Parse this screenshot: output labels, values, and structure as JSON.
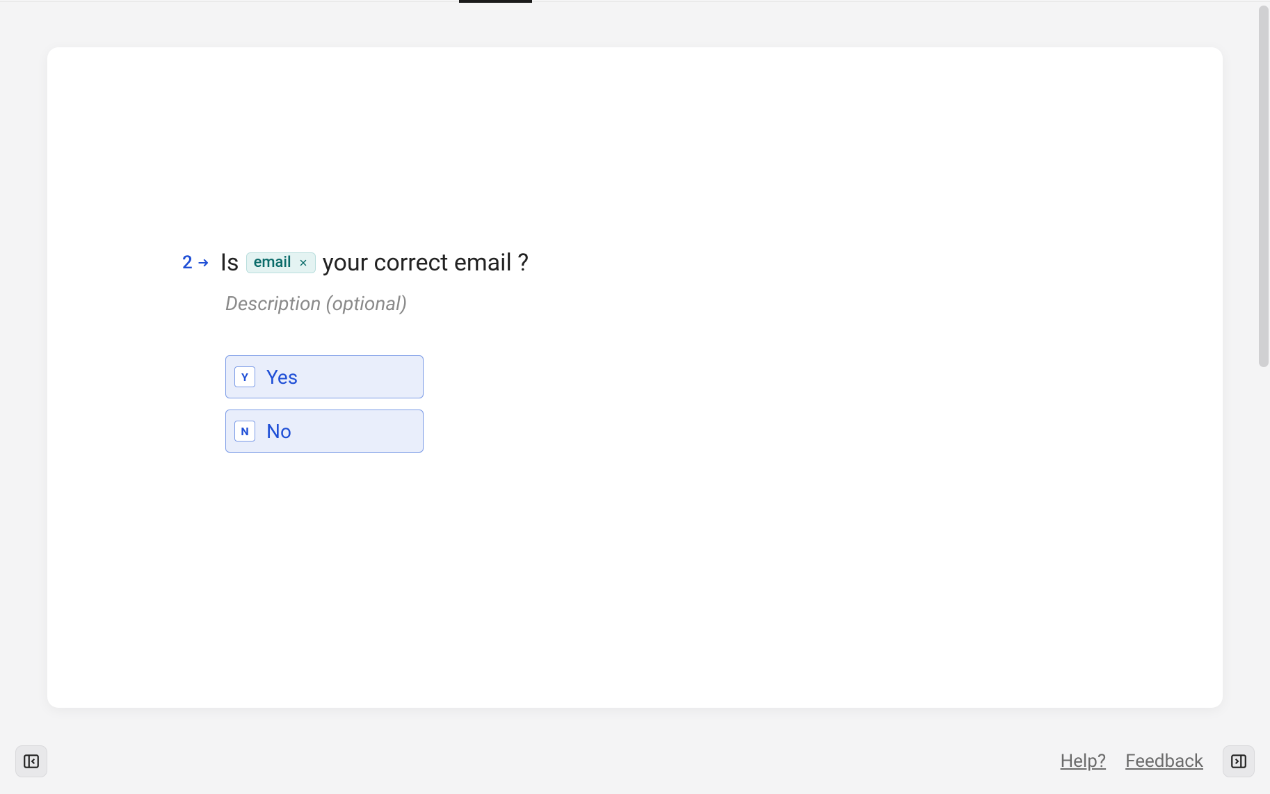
{
  "question": {
    "number": "2",
    "before": "Is",
    "chip": "email",
    "after": "your correct email ?",
    "description_placeholder": "Description (optional)"
  },
  "options": [
    {
      "key": "Y",
      "label": "Yes"
    },
    {
      "key": "N",
      "label": "No"
    }
  ],
  "footer": {
    "help": "Help?",
    "feedback": "Feedback"
  }
}
